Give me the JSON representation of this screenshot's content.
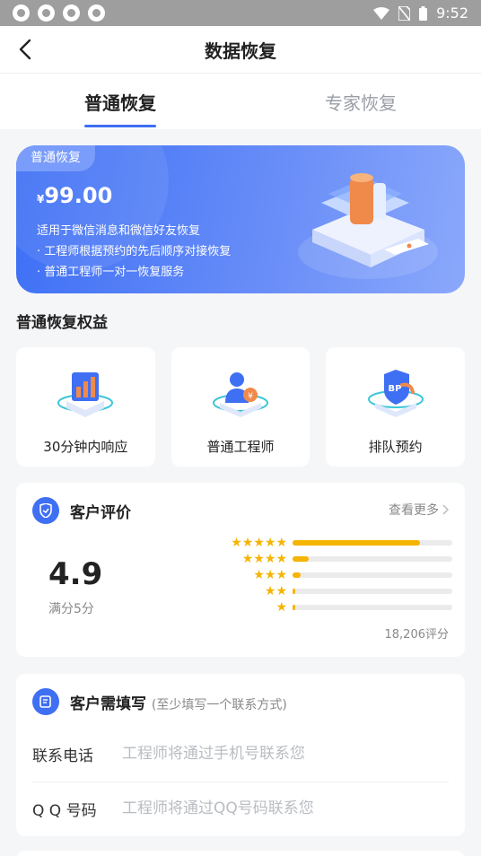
{
  "status_bar": {
    "time": "9:52"
  },
  "nav": {
    "title": "数据恢复"
  },
  "tabs": [
    {
      "label": "普通恢复",
      "active": true
    },
    {
      "label": "专家恢复",
      "active": false
    }
  ],
  "banner": {
    "tag": "普通恢复",
    "currency": "¥",
    "price": "99.00",
    "lines": [
      "适用于微信消息和微信好友恢复",
      "· 工程师根据预约的先后顺序对接恢复",
      "· 普通工程师一对一恢复服务"
    ]
  },
  "benefits": {
    "title": "普通恢复权益",
    "items": [
      {
        "label": "30分钟内响应",
        "icon": "speed-chart-icon"
      },
      {
        "label": "普通工程师",
        "icon": "engineer-icon"
      },
      {
        "label": "排队预约",
        "icon": "appointment-shield-icon"
      }
    ]
  },
  "reviews": {
    "title": "客户评价",
    "more": "查看更多",
    "score": "4.9",
    "score_sub": "满分5分",
    "count": "18,206评分",
    "distribution": [
      {
        "stars": 5,
        "fraction": 0.8
      },
      {
        "stars": 4,
        "fraction": 0.1
      },
      {
        "stars": 3,
        "fraction": 0.05
      },
      {
        "stars": 2,
        "fraction": 0.015
      },
      {
        "stars": 1,
        "fraction": 0.015
      }
    ]
  },
  "form": {
    "title": "客户需填写",
    "subtitle": "(至少填写一个联系方式)",
    "fields": [
      {
        "label": "联系电话",
        "placeholder": "工程师将通过手机号联系您"
      },
      {
        "label": "Q Q 号码",
        "placeholder": "工程师将通过QQ号码联系您"
      }
    ]
  },
  "colors": {
    "primary": "#3f6ff3",
    "star": "#f4b400"
  }
}
